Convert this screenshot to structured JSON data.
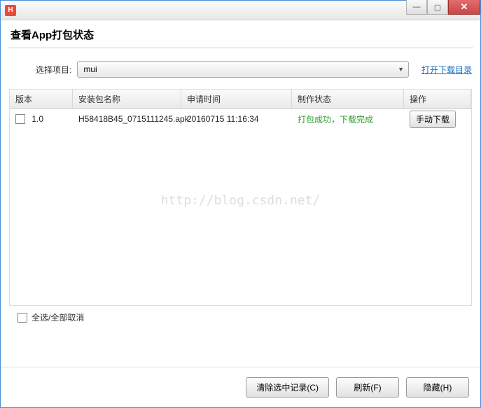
{
  "titleBar": {
    "icon": "H",
    "faded_title": ""
  },
  "windowTitle": "查看App打包状态",
  "projectRow": {
    "label": "选择项目:",
    "selected": "mui",
    "openLink": "打开下载目录"
  },
  "table": {
    "headers": {
      "version": "版本",
      "package": "安装包名称",
      "time": "申请时间",
      "status": "制作状态",
      "operation": "操作"
    },
    "rows": [
      {
        "version": "1.0",
        "package": "H58418B45_0715111245.apk",
        "time": "20160715 11:16:34",
        "status": "打包成功，下载完成",
        "operation": "手动下载"
      }
    ]
  },
  "selectAll": "全选/全部取消",
  "buttons": {
    "clear": "清除选中记录(C)",
    "refresh": "刷新(F)",
    "hide": "隐藏(H)"
  },
  "watermark": "http://blog.csdn.net/"
}
